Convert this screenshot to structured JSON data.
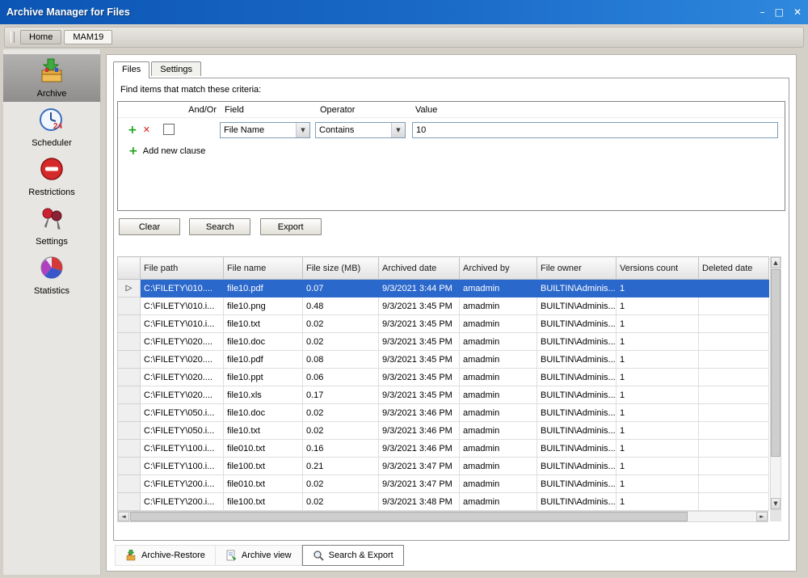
{
  "window": {
    "title": "Archive Manager for Files"
  },
  "icons": {
    "plus": "+",
    "cross": "✕",
    "dropdown": "▼",
    "up": "▲",
    "down": "▼",
    "left": "◄",
    "right": "►",
    "marker": "▷",
    "minimize": "–",
    "maximize": "□",
    "close": "✕"
  },
  "toolbar": {
    "home": "Home",
    "mam19": "MAM19"
  },
  "sidebar": {
    "items": [
      {
        "label": "Archive"
      },
      {
        "label": "Scheduler"
      },
      {
        "label": "Restrictions"
      },
      {
        "label": "Settings"
      },
      {
        "label": "Statistics"
      }
    ]
  },
  "tabs": {
    "files": "Files",
    "settings": "Settings"
  },
  "criteria": {
    "heading": "Find items that match these criteria:",
    "columns": {
      "andor": "And/Or",
      "field": "Field",
      "operator": "Operator",
      "value": "Value"
    },
    "row": {
      "field": "File Name",
      "operator": "Contains",
      "value": "10"
    },
    "add_clause": "Add new clause"
  },
  "actions": {
    "clear": "Clear",
    "search": "Search",
    "export": "Export"
  },
  "table": {
    "selected_index": 0,
    "columns": [
      "File path",
      "File name",
      "File size (MB)",
      "Archived date",
      "Archived by",
      "File owner",
      "Versions count",
      "Deleted date"
    ],
    "rows": [
      [
        "C:\\FILETY\\010....",
        "file10.pdf",
        "0.07",
        "9/3/2021 3:44 PM",
        "amadmin",
        "BUILTIN\\Adminis...",
        "1",
        ""
      ],
      [
        "C:\\FILETY\\010.i...",
        "file10.png",
        "0.48",
        "9/3/2021 3:45 PM",
        "amadmin",
        "BUILTIN\\Adminis...",
        "1",
        ""
      ],
      [
        "C:\\FILETY\\010.i...",
        "file10.txt",
        "0.02",
        "9/3/2021 3:45 PM",
        "amadmin",
        "BUILTIN\\Adminis...",
        "1",
        ""
      ],
      [
        "C:\\FILETY\\020....",
        "file10.doc",
        "0.02",
        "9/3/2021 3:45 PM",
        "amadmin",
        "BUILTIN\\Adminis...",
        "1",
        ""
      ],
      [
        "C:\\FILETY\\020....",
        "file10.pdf",
        "0.08",
        "9/3/2021 3:45 PM",
        "amadmin",
        "BUILTIN\\Adminis...",
        "1",
        ""
      ],
      [
        "C:\\FILETY\\020....",
        "file10.ppt",
        "0.06",
        "9/3/2021 3:45 PM",
        "amadmin",
        "BUILTIN\\Adminis...",
        "1",
        ""
      ],
      [
        "C:\\FILETY\\020....",
        "file10.xls",
        "0.17",
        "9/3/2021 3:45 PM",
        "amadmin",
        "BUILTIN\\Adminis...",
        "1",
        ""
      ],
      [
        "C:\\FILETY\\050.i...",
        "file10.doc",
        "0.02",
        "9/3/2021 3:46 PM",
        "amadmin",
        "BUILTIN\\Adminis...",
        "1",
        ""
      ],
      [
        "C:\\FILETY\\050.i...",
        "file10.txt",
        "0.02",
        "9/3/2021 3:46 PM",
        "amadmin",
        "BUILTIN\\Adminis...",
        "1",
        ""
      ],
      [
        "C:\\FILETY\\100.i...",
        "file010.txt",
        "0.16",
        "9/3/2021 3:46 PM",
        "amadmin",
        "BUILTIN\\Adminis...",
        "1",
        ""
      ],
      [
        "C:\\FILETY\\100.i...",
        "file100.txt",
        "0.21",
        "9/3/2021 3:47 PM",
        "amadmin",
        "BUILTIN\\Adminis...",
        "1",
        ""
      ],
      [
        "C:\\FILETY\\200.i...",
        "file010.txt",
        "0.02",
        "9/3/2021 3:47 PM",
        "amadmin",
        "BUILTIN\\Adminis...",
        "1",
        ""
      ],
      [
        "C:\\FILETY\\200.i...",
        "file100.txt",
        "0.02",
        "9/3/2021 3:48 PM",
        "amadmin",
        "BUILTIN\\Adminis...",
        "1",
        ""
      ]
    ]
  },
  "bottom_tabs": {
    "archive_restore": "Archive-Restore",
    "archive_view": "Archive view",
    "search_export": "Search & Export"
  },
  "colors": {
    "titlebar": "#1a6ac8",
    "selected_row": "#2b68cc",
    "accent_green": "#17a317",
    "accent_red": "#d42020"
  }
}
